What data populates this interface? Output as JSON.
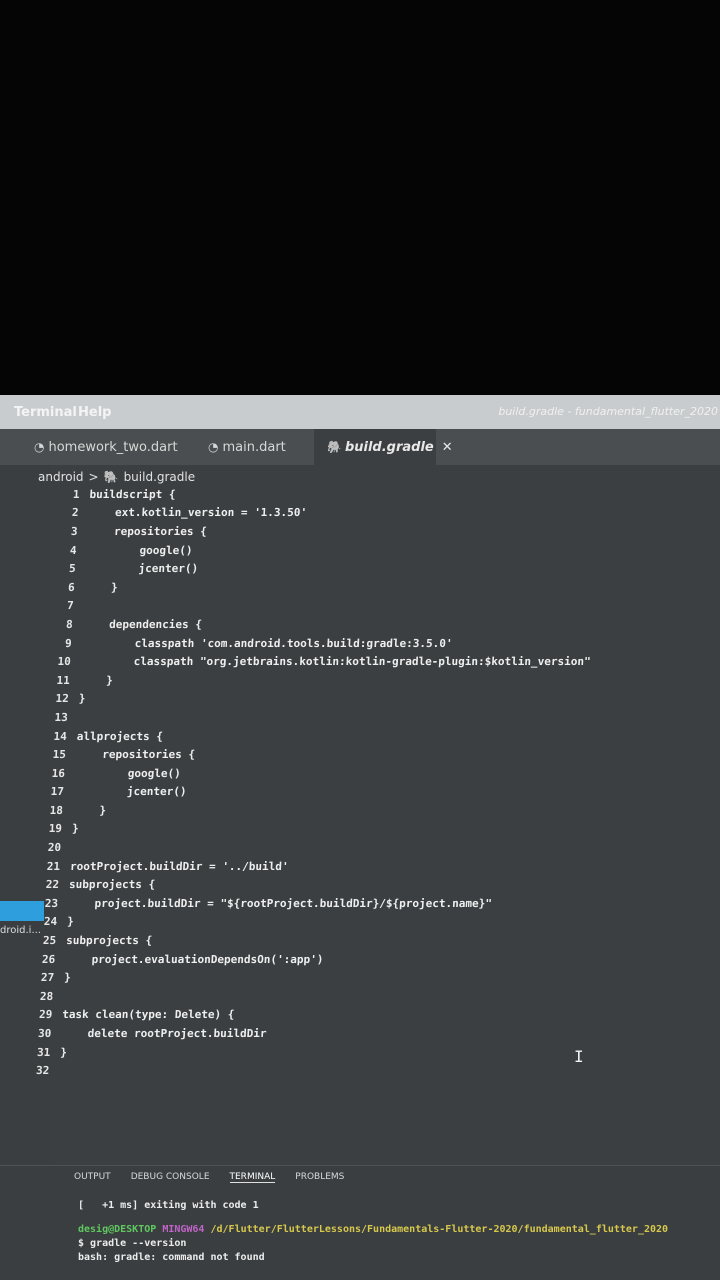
{
  "menubar": {
    "items": [
      "Terminal",
      "Help"
    ],
    "window_title": "build.gradle - fundamental_flutter_2020"
  },
  "tabs": [
    {
      "label": "homework_two.dart",
      "icon": "dart-icon"
    },
    {
      "label": "main.dart",
      "icon": "dart-icon"
    },
    {
      "label": "build.gradle",
      "icon": "gradle-icon",
      "active": true
    }
  ],
  "breadcrumb": {
    "folder": "android",
    "separator": ">",
    "file": "build.gradle"
  },
  "sidebar": {
    "label": "droid.i..."
  },
  "code_lines": [
    "buildscript {",
    "    ext.kotlin_version = '1.3.50'",
    "    repositories {",
    "        google()",
    "        jcenter()",
    "    }",
    "",
    "    dependencies {",
    "        classpath 'com.android.tools.build:gradle:3.5.0'",
    "        classpath \"org.jetbrains.kotlin:kotlin-gradle-plugin:$kotlin_version\"",
    "    }",
    "}",
    "",
    "allprojects {",
    "    repositories {",
    "        google()",
    "        jcenter()",
    "    }",
    "}",
    "",
    "rootProject.buildDir = '../build'",
    "subprojects {",
    "    project.buildDir = \"${rootProject.buildDir}/${project.name}\"",
    "}",
    "subprojects {",
    "    project.evaluationDependsOn(':app')",
    "}",
    "",
    "task clean(type: Delete) {",
    "    delete rootProject.buildDir",
    "}",
    ""
  ],
  "line_numbers": [
    "1",
    "2",
    "3",
    "4",
    "5",
    "6",
    "7",
    "8",
    "9",
    "10",
    "11",
    "12",
    "13",
    "14",
    "15",
    "16",
    "17",
    "18",
    "19",
    "20",
    "21",
    "22",
    "23",
    "24",
    "25",
    "26",
    "27",
    "28",
    "29",
    "30",
    "31",
    "32"
  ],
  "panel": {
    "tabs": [
      "OUTPUT",
      "DEBUG CONSOLE",
      "TERMINAL",
      "PROBLEMS"
    ],
    "active_tab": "TERMINAL"
  },
  "terminal": {
    "line1": "[   +1 ms] exiting with code 1",
    "user": "desig@DESKTOP",
    "shell": "MINGW64",
    "path": "/d/Flutter/FlutterLessons/Fundamentals-Flutter-2020/fundamental_flutter_2020",
    "command": "$ gradle --version",
    "error": "bash: gradle: command not found"
  },
  "colors": {
    "accent": "#2e9fdc",
    "editor_bg": "#3b3f42"
  }
}
